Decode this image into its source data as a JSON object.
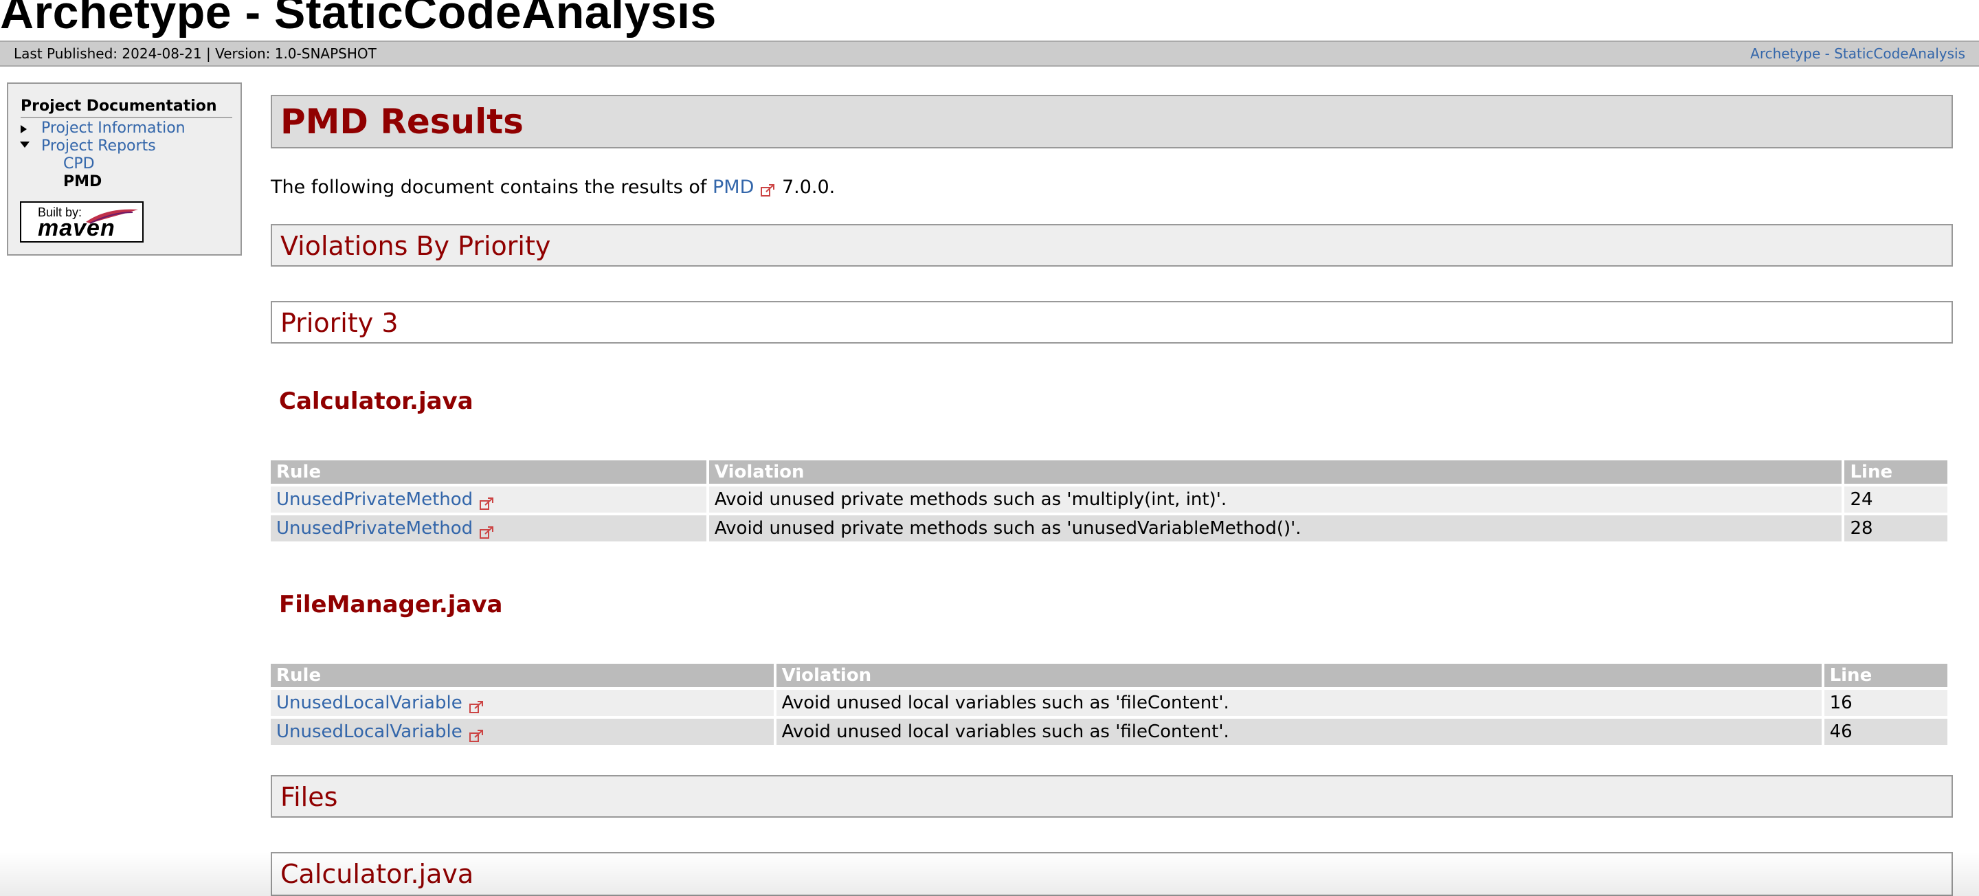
{
  "site": {
    "title": "Archetype - StaticCodeAnalysis"
  },
  "breadcrumbs": {
    "published": "Last Published: 2024-08-21 | Version: 1.0-SNAPSHOT",
    "right_link": "Archetype - StaticCodeAnalysis"
  },
  "nav": {
    "heading": "Project Documentation",
    "items": [
      {
        "label": "Project Information",
        "expanded": false
      },
      {
        "label": "Project Reports",
        "expanded": true
      }
    ],
    "subitems": [
      {
        "label": "CPD",
        "current": false
      },
      {
        "label": "PMD",
        "current": true
      }
    ],
    "badge": {
      "built": "Built by:",
      "word": "maven"
    }
  },
  "main": {
    "page_title": "PMD Results",
    "intro_prefix": "The following document contains the results of",
    "intro_link": "PMD",
    "intro_suffix": "7.0.0.",
    "section_violations": "Violations By Priority",
    "priority_heading": "Priority 3",
    "files": [
      {
        "name": "Calculator.java",
        "headers": {
          "rule": "Rule",
          "violation": "Violation",
          "line": "Line"
        },
        "rows": [
          {
            "rule": "UnusedPrivateMethod",
            "violation": "Avoid unused private methods such as 'multiply(int, int)'.",
            "line": "24"
          },
          {
            "rule": "UnusedPrivateMethod",
            "violation": "Avoid unused private methods such as 'unusedVariableMethod()'.",
            "line": "28"
          }
        ]
      },
      {
        "name": "FileManager.java",
        "headers": {
          "rule": "Rule",
          "violation": "Violation",
          "line": "Line"
        },
        "rows": [
          {
            "rule": "UnusedLocalVariable",
            "violation": "Avoid unused local variables such as 'fileContent'.",
            "line": "16"
          },
          {
            "rule": "UnusedLocalVariable",
            "violation": "Avoid unused local variables such as 'fileContent'.",
            "line": "46"
          }
        ]
      }
    ],
    "section_files": "Files",
    "files_first_heading": "Calculator.java"
  },
  "colors": {
    "heading_red": "#900000",
    "link_blue": "#3366aa",
    "table_header": "#bbbbbb",
    "row_a": "#eeeeee",
    "row_b": "#dddddd"
  }
}
